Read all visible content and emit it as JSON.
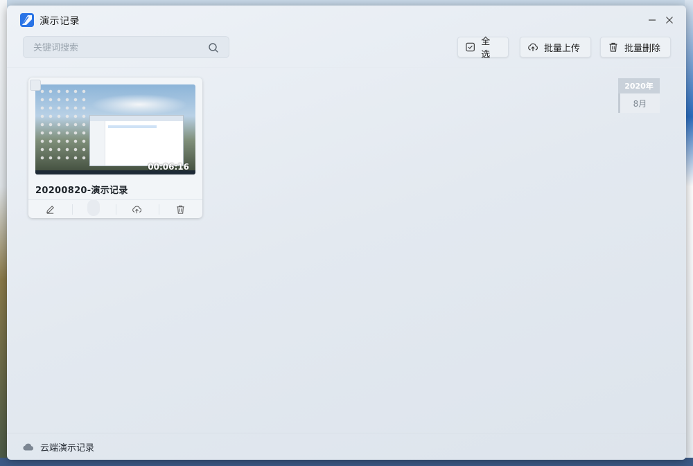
{
  "window": {
    "title": "演示记录"
  },
  "toolbar": {
    "search_placeholder": "关键词搜索",
    "select_all_label": "全选",
    "batch_upload_label": "批量上传",
    "batch_delete_label": "批量删除"
  },
  "recordings": [
    {
      "title": "20200820-演示记录",
      "duration": "00:06:16"
    }
  ],
  "timeline": {
    "year": "2020年",
    "month": "8月"
  },
  "footer": {
    "cloud_label": "云端演示记录"
  },
  "colors": {
    "window_bg": "#e3e9f0",
    "logo_accent": "#2a74e6",
    "text_primary": "#1d2329"
  },
  "icons": {
    "app_logo": "presentation-pen-icon",
    "search": "search-icon",
    "select_all": "checkbox-icon",
    "upload": "cloud-upload-icon",
    "delete": "trash-icon",
    "edit": "pencil-icon",
    "cloud": "cloud-icon"
  }
}
